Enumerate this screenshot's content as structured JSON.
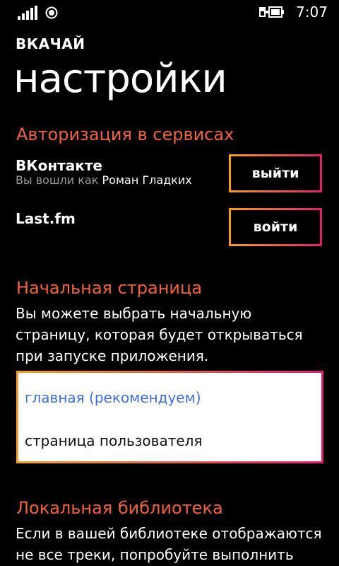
{
  "status_bar": {
    "time": "7:07",
    "icons": [
      "signal-icon",
      "wifi-icon",
      "battery-charging-icon"
    ]
  },
  "header": {
    "app_title": "ВКАЧАЙ",
    "page_title": "настройки"
  },
  "auth": {
    "title": "Авторизация в сервисах",
    "vk": {
      "name": "ВКонтакте",
      "status_prefix": "Вы вошли как",
      "user": "Роман Гладких",
      "button": "выйти"
    },
    "lastfm": {
      "name": "Last.fm",
      "button": "войти"
    }
  },
  "start_page": {
    "title": "Начальная страница",
    "description": "Вы можете выбрать начальную страницу, которая будет открываться при запуске приложения.",
    "options": [
      "главная (рекомендуем)",
      "страница пользователя"
    ],
    "selected": "главная (рекомендуем)"
  },
  "library": {
    "title": "Локальная библиотека",
    "description": "Если в вашей библиотеке отображаются не все треки, попробуйте выполнить"
  },
  "colors": {
    "accent": "#f0633c",
    "gradient_start": "#f4a01e",
    "gradient_end": "#e01e6e",
    "selected_option": "#3d6fd6",
    "subtle_text": "#9a9a9a"
  }
}
